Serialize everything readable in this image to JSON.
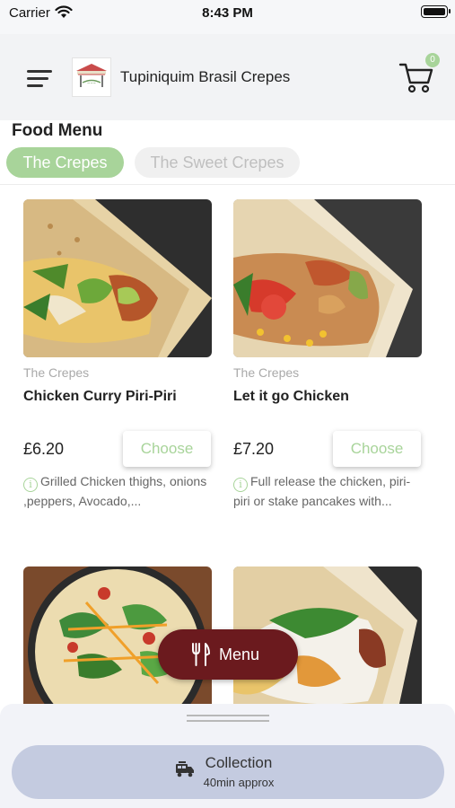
{
  "status_bar": {
    "carrier": "Carrier",
    "time": "8:43 PM"
  },
  "header": {
    "title": "Tupiniquim Brasil Crepes",
    "cart_count": "0",
    "icons": [
      "hamburger-menu-icon",
      "logo",
      "cart-icon"
    ]
  },
  "menu": {
    "title": "Food Menu",
    "tabs": [
      {
        "label": "The Crepes",
        "active": true
      },
      {
        "label": "The Sweet Crepes",
        "active": false
      }
    ]
  },
  "products": [
    {
      "category": "The Crepes",
      "name": "Chicken Curry Piri-Piri",
      "price": "£6.20",
      "button": "Choose",
      "description": "Grilled Chicken thighs, onions ,peppers, Avocado,..."
    },
    {
      "category": "The Crepes",
      "name": "Let it go Chicken",
      "price": "£7.20",
      "button": "Choose",
      "description": "Full release the chicken, piri-piri or stake pancakes with..."
    },
    {
      "image": "crepe-salad-photo"
    },
    {
      "image": "crepe-wrap-photo"
    }
  ],
  "fab": {
    "label": "Menu",
    "icon": "fork-knife-icon"
  },
  "footer": {
    "collection_label": "Collection",
    "collection_time": "40min approx",
    "icon": "collection-vehicle-icon"
  },
  "colors": {
    "accent_green": "#a8d49a",
    "fab_maroon": "#6b1a1e",
    "collection_bg": "#c4cbe0",
    "header_bg": "#f2f3f5"
  }
}
